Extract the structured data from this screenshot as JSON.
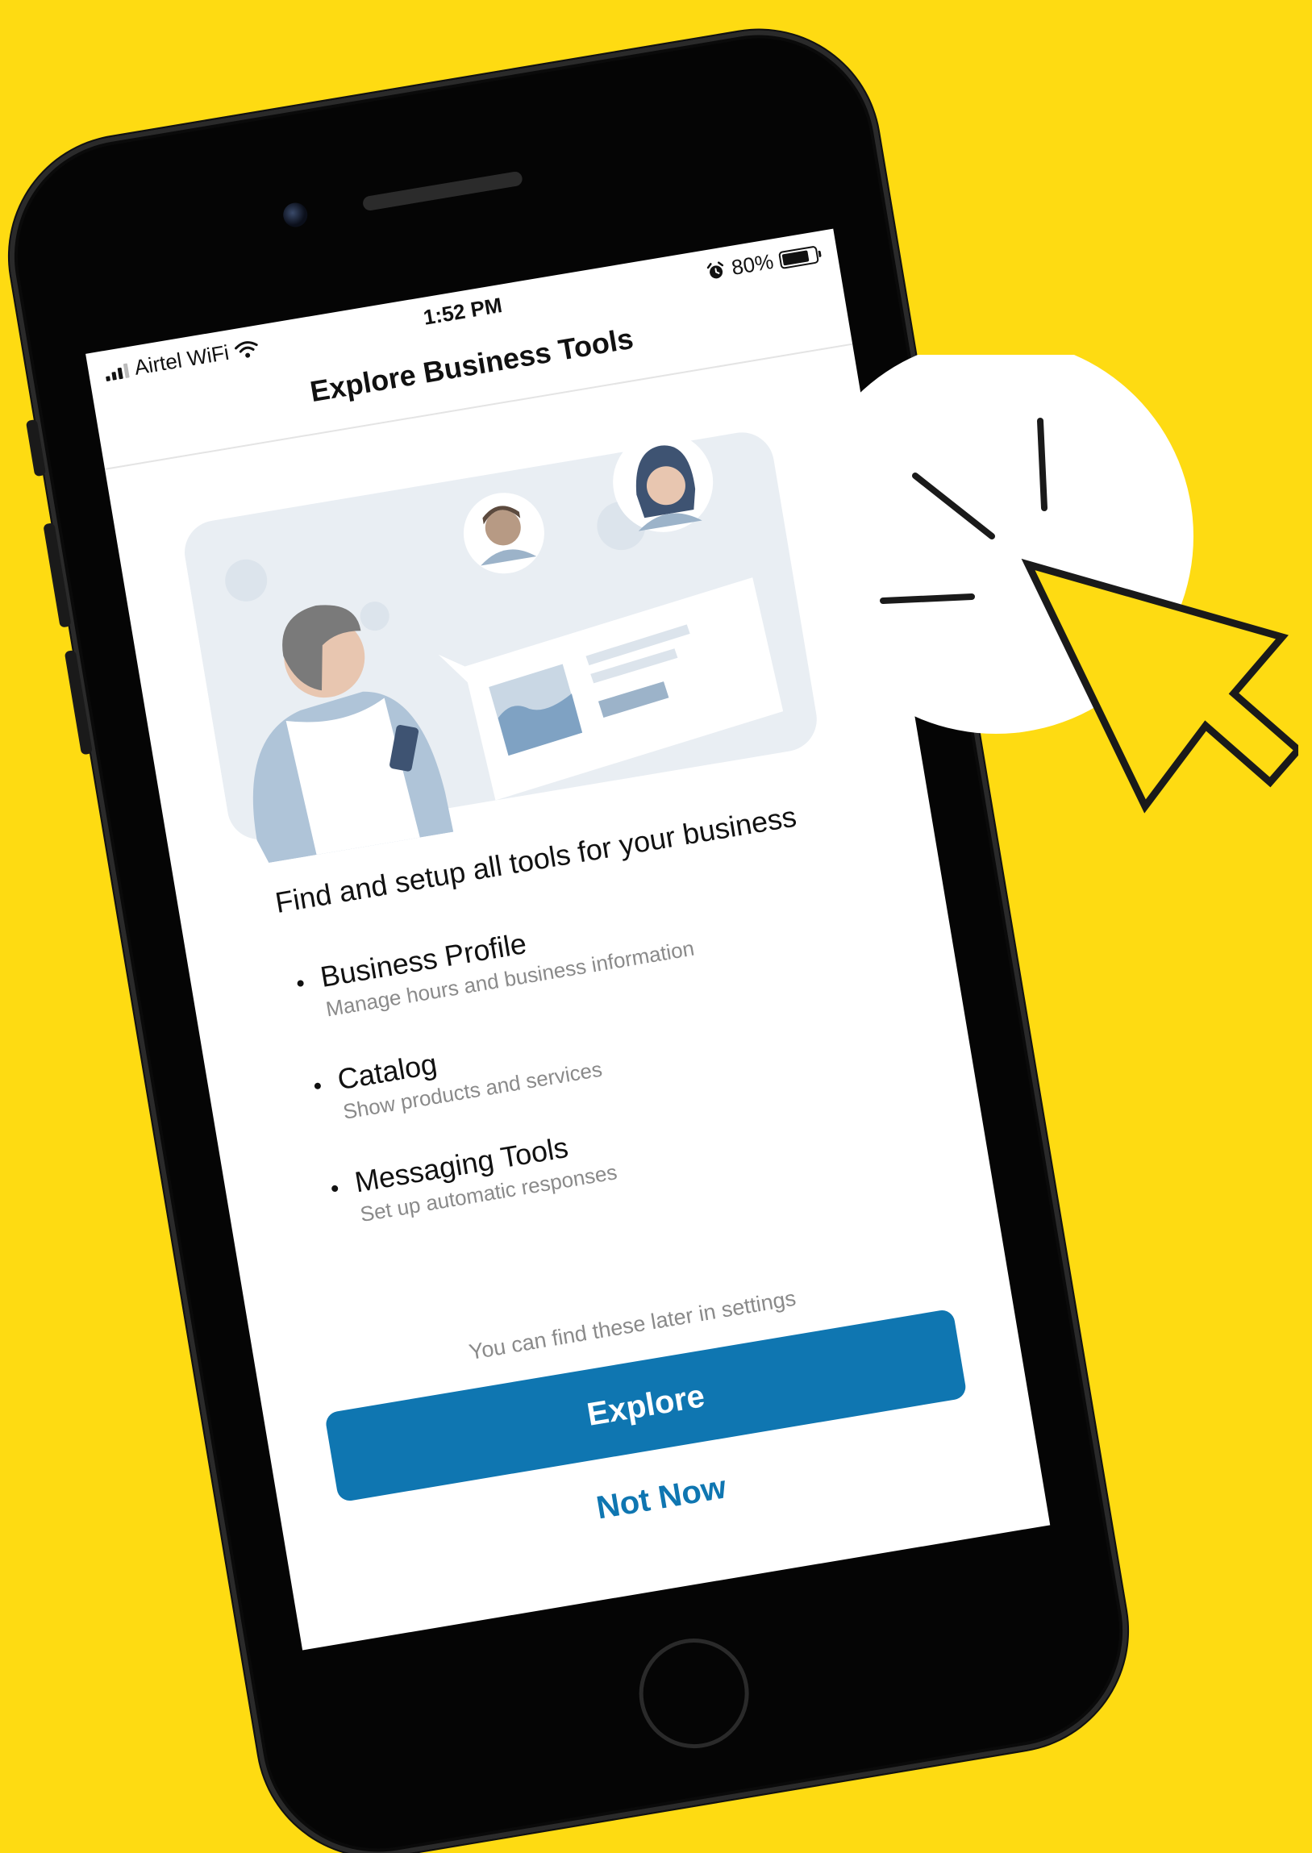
{
  "status_bar": {
    "carrier": "Airtel WiFi",
    "time": "1:52 PM",
    "battery_percent": "80%",
    "battery_level": 0.8
  },
  "nav": {
    "title": "Explore Business Tools"
  },
  "main": {
    "headline": "Find and setup all tools for your business",
    "tools": [
      {
        "title": "Business Profile",
        "subtitle": "Manage hours and business information"
      },
      {
        "title": "Catalog",
        "subtitle": "Show products and services"
      },
      {
        "title": "Messaging Tools",
        "subtitle": "Set up automatic responses"
      }
    ]
  },
  "footer": {
    "note": "You can find these later in settings",
    "explore_label": "Explore",
    "not_now_label": "Not Now"
  },
  "colors": {
    "background": "#FEDB12",
    "accent": "#0F76B1",
    "illustration": "#E9EEF3"
  },
  "icons": {
    "signal": "signal-bars-icon",
    "wifi": "wifi-icon",
    "alarm": "alarm-icon",
    "battery": "battery-icon",
    "cursor": "click-cursor-icon"
  }
}
